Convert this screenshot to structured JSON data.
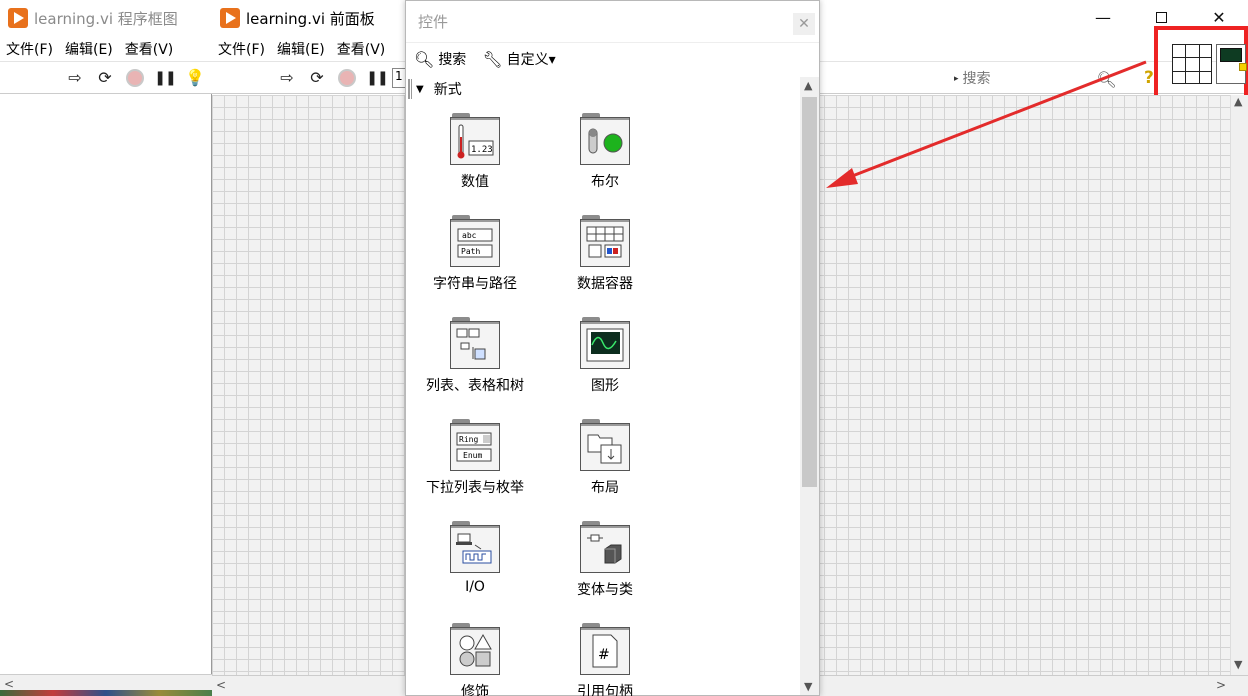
{
  "block_diagram": {
    "title": "learning.vi 程序框图",
    "menus": [
      "文件(F)",
      "编辑(E)",
      "查看(V)"
    ]
  },
  "front_panel": {
    "title": "learning.vi 前面板",
    "menus": [
      "文件(F)",
      "编辑(E)",
      "查看(V)"
    ],
    "toolbar_number": "1",
    "search_placeholder": "搜索",
    "window_controls": {
      "minimize": "—",
      "maximize": "□",
      "close": "✕"
    }
  },
  "palette": {
    "title": "控件",
    "search_label": "搜索",
    "customize_label": "自定义▾",
    "category": "新式",
    "items": [
      {
        "label": "数值",
        "icon": "numeric-icon"
      },
      {
        "label": "布尔",
        "icon": "boolean-icon"
      },
      {
        "label": "字符串与路径",
        "icon": "string-path-icon"
      },
      {
        "label": "数据容器",
        "icon": "array-cluster-icon"
      },
      {
        "label": "列表、表格和树",
        "icon": "list-table-tree-icon"
      },
      {
        "label": "图形",
        "icon": "graph-icon"
      },
      {
        "label": "下拉列表与枚举",
        "icon": "ring-enum-icon"
      },
      {
        "label": "布局",
        "icon": "containers-icon"
      },
      {
        "label": "I/O",
        "icon": "io-icon"
      },
      {
        "label": "变体与类",
        "icon": "variant-class-icon"
      },
      {
        "label": "修饰",
        "icon": "decorations-icon"
      },
      {
        "label": "引用句柄",
        "icon": "refnum-icon"
      }
    ]
  },
  "annotation": {
    "highlight_color": "#e02020"
  }
}
